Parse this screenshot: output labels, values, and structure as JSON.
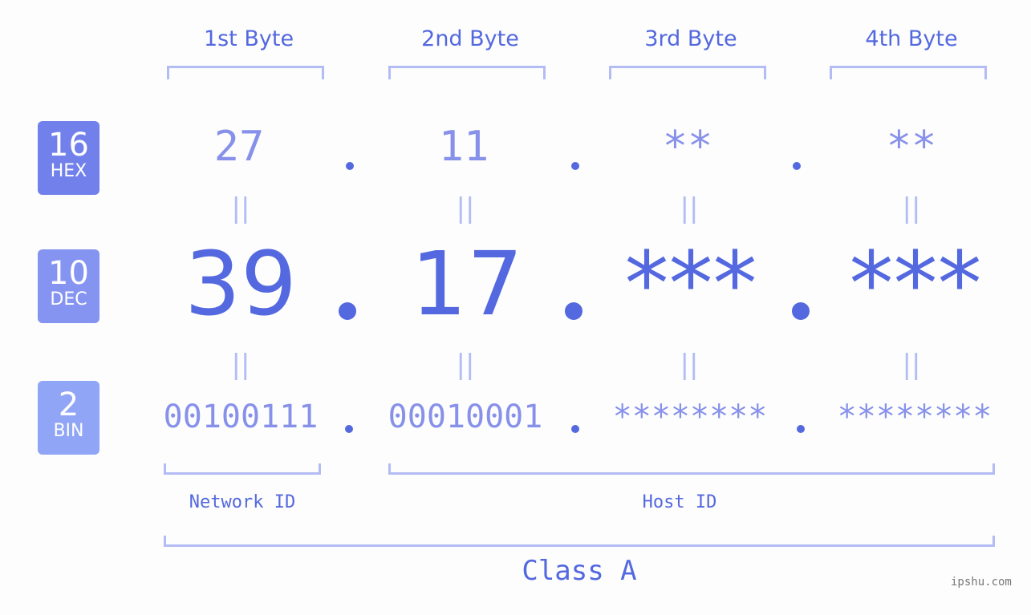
{
  "columns": [
    "1st Byte",
    "2nd Byte",
    "3rd Byte",
    "4th Byte"
  ],
  "rows": {
    "hex": {
      "base": "16",
      "label": "HEX",
      "values": [
        "27",
        "11",
        "**",
        "**"
      ]
    },
    "dec": {
      "base": "10",
      "label": "DEC",
      "values": [
        "39",
        "17",
        "***",
        "***"
      ]
    },
    "bin": {
      "base": "2",
      "label": "BIN",
      "values": [
        "00100111",
        "00010001",
        "********",
        "********"
      ]
    }
  },
  "badge_colors": {
    "hex": "#7180ea",
    "dec": "#8694f1",
    "bin": "#90a5f6"
  },
  "equals_glyph": "||",
  "segments": {
    "network": "Network ID",
    "host": "Host ID"
  },
  "class_label": "Class A",
  "watermark": "ipshu.com"
}
